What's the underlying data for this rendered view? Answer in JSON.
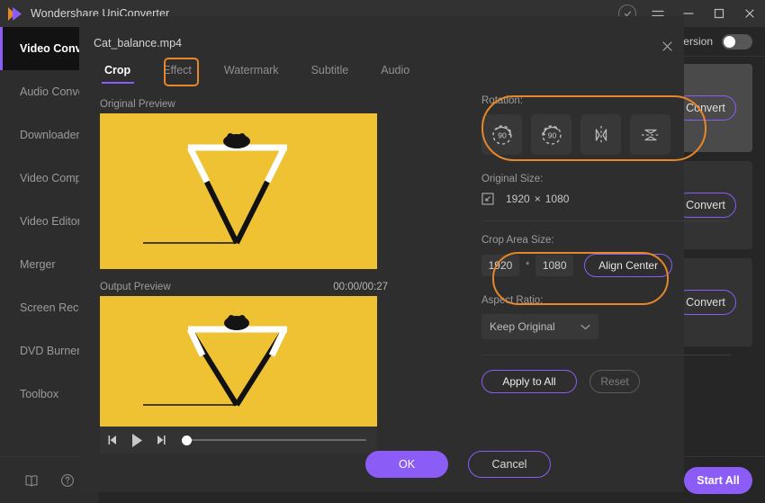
{
  "titlebar": {
    "app_title": "Wondershare UniConverter",
    "logo_icon": "play-logo-icon",
    "account_icon": "account-icon",
    "menu_icon": "hamburger-menu-icon",
    "minimize_icon": "minimize-icon",
    "maximize_icon": "maximize-icon",
    "close_icon": "close-icon"
  },
  "sidebar": {
    "items": [
      {
        "label": "Video Converter",
        "active": true
      },
      {
        "label": "Audio Converter",
        "active": false
      },
      {
        "label": "Downloader",
        "active": false
      },
      {
        "label": "Video Compressor",
        "active": false
      },
      {
        "label": "Video Editor",
        "active": false
      },
      {
        "label": "Merger",
        "active": false
      },
      {
        "label": "Screen Recorder",
        "active": false
      },
      {
        "label": "DVD Burner",
        "active": false
      },
      {
        "label": "Toolbox",
        "active": false
      }
    ],
    "bottom_icons": [
      "book-icon",
      "help-icon"
    ]
  },
  "main": {
    "conversion_label": "Conversion",
    "toggle_state": "off",
    "cards": [
      {
        "convert_label": "Convert"
      },
      {
        "convert_label": "Convert"
      },
      {
        "convert_label": "Convert"
      }
    ],
    "start_all_label": "Start All"
  },
  "modal": {
    "filename": "Cat_balance.mp4",
    "close_icon": "close-icon",
    "tabs": [
      {
        "label": "Crop",
        "active": true
      },
      {
        "label": "Effect",
        "active": false
      },
      {
        "label": "Watermark",
        "active": false
      },
      {
        "label": "Subtitle",
        "active": false
      },
      {
        "label": "Audio",
        "active": false
      }
    ],
    "preview": {
      "original_label": "Original Preview",
      "output_label": "Output Preview",
      "timecode": "00:00/00:27",
      "controls": {
        "prev_frame_icon": "previous-frame-icon",
        "play_icon": "play-icon",
        "next_frame_icon": "next-frame-icon",
        "progress_percent": 0
      }
    },
    "settings": {
      "rotation_label": "Rotation:",
      "rotation_buttons": [
        {
          "name": "rotate-right-90",
          "text": "90"
        },
        {
          "name": "rotate-left-90",
          "text": "90"
        },
        {
          "name": "flip-horizontal",
          "text": ""
        },
        {
          "name": "flip-vertical",
          "text": ""
        }
      ],
      "original_size_label": "Original Size:",
      "original_size_icon": "expand-icon",
      "original_width": "1920",
      "original_separator": "×",
      "original_height": "1080",
      "crop_area_label": "Crop Area Size:",
      "crop_width": "1920",
      "crop_separator": "*",
      "crop_height": "1080",
      "align_center_label": "Align Center",
      "aspect_ratio_label": "Aspect Ratio:",
      "aspect_ratio_value": "Keep Original",
      "aspect_ratio_caret": "chevron-down-icon",
      "apply_to_all_label": "Apply to All",
      "reset_label": "Reset"
    },
    "footer": {
      "ok_label": "OK",
      "cancel_label": "Cancel"
    },
    "highlights": [
      {
        "name": "crop-tab-highlight",
        "color": "#e8862a"
      },
      {
        "name": "rotation-section-highlight",
        "color": "#e8862a"
      },
      {
        "name": "crop-area-size-highlight",
        "color": "#e8862a"
      }
    ]
  },
  "colors": {
    "accent_purple": "#8b5cf6",
    "highlight_orange": "#e8862a",
    "video_yellow": "#efc233",
    "window_bg": "#2b2b2b",
    "modal_bg": "#2e2e2e"
  }
}
